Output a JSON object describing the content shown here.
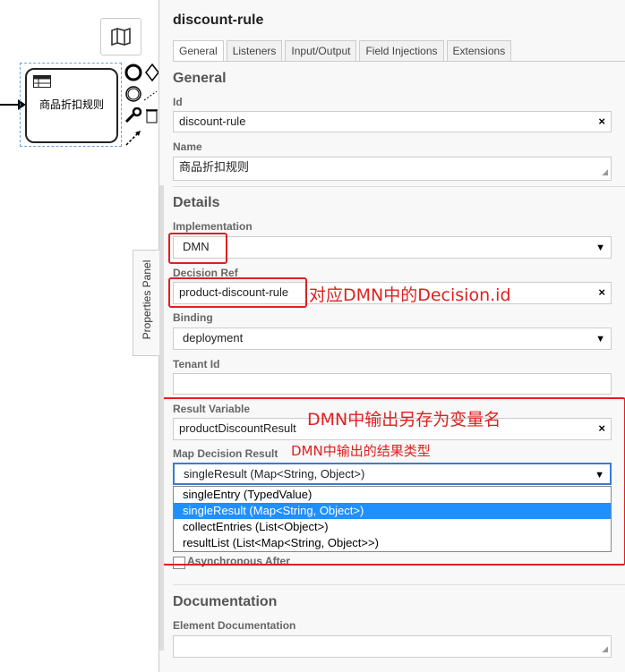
{
  "canvas": {
    "task_label": "商品折扣规则",
    "properties_panel_tab": "Properties Panel"
  },
  "panel": {
    "element_id_title": "discount-rule",
    "tabs": [
      "General",
      "Listeners",
      "Input/Output",
      "Field Injections",
      "Extensions"
    ],
    "general": {
      "group_title": "General",
      "id_label": "Id",
      "id_value": "discount-rule",
      "name_label": "Name",
      "name_value": "商品折扣规则"
    },
    "details": {
      "group_title": "Details",
      "implementation_label": "Implementation",
      "implementation_value": "DMN",
      "decision_ref_label": "Decision Ref",
      "decision_ref_value": "product-discount-rule",
      "binding_label": "Binding",
      "binding_value": "deployment",
      "tenant_label": "Tenant Id",
      "tenant_value": "",
      "result_variable_label": "Result Variable",
      "result_variable_value": "productDiscountResult",
      "map_decision_label": "Map Decision Result",
      "map_decision_value": "singleResult (Map<String, Object>)",
      "map_decision_options": [
        "singleEntry (TypedValue)",
        "singleResult (Map<String, Object>)",
        "collectEntries (List<Object>)",
        "resultList (List<Map<String, Object>>)"
      ],
      "async_after_label": "Asynchronous After"
    },
    "documentation": {
      "group_title": "Documentation",
      "element_doc_label": "Element Documentation",
      "element_doc_value": ""
    }
  },
  "annotations": {
    "decision_note": "对应DMN中的Decision.id",
    "result_var_note": "DMN中输出另存为变量名",
    "map_result_note": "DMN中输出的结果类型"
  },
  "colors": {
    "annotation_red": "#e02020",
    "selected_option": "#1e90ff"
  }
}
